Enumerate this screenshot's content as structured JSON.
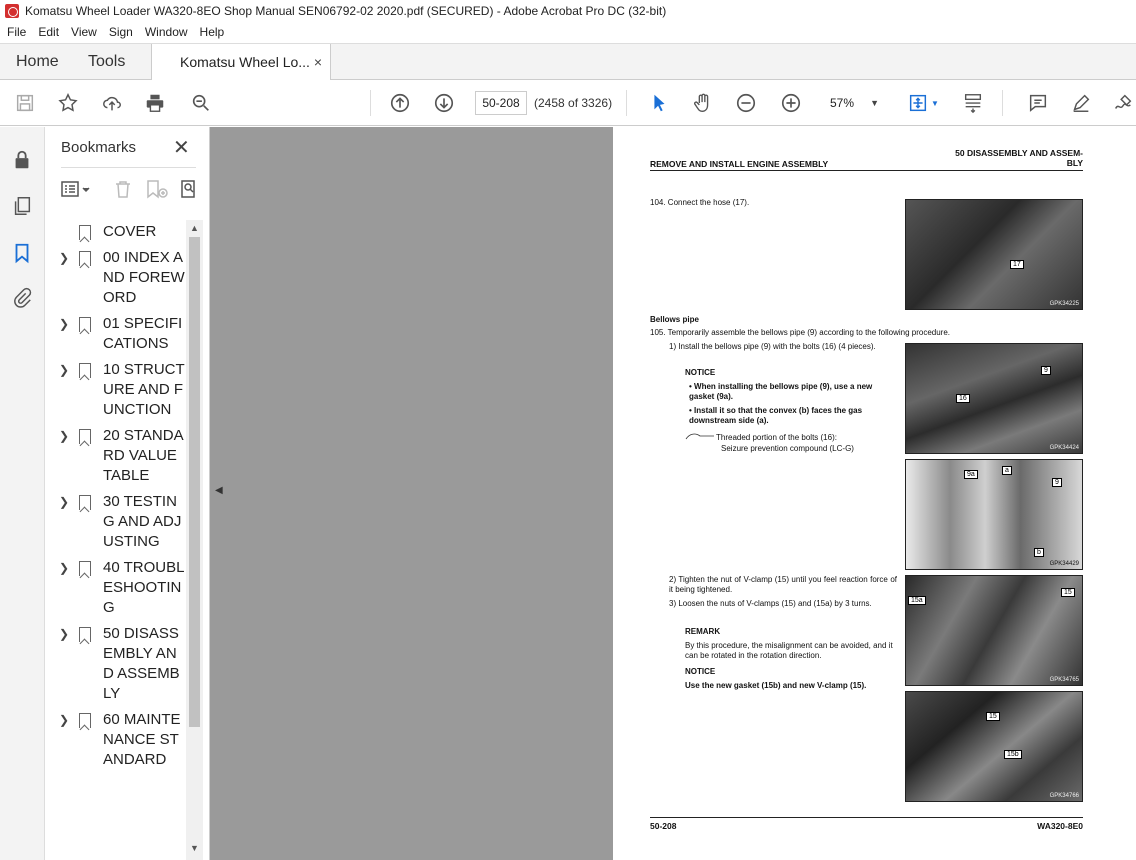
{
  "window": {
    "title": "Komatsu Wheel Loader WA320-8EO Shop Manual SEN06792-02 2020.pdf (SECURED) - Adobe Acrobat Pro DC (32-bit)"
  },
  "menu": [
    "File",
    "Edit",
    "View",
    "Sign",
    "Window",
    "Help"
  ],
  "tabs": {
    "home": "Home",
    "tools": "Tools",
    "doc": "Komatsu Wheel Lo...",
    "close": "×"
  },
  "toolbar": {
    "page_input": "50-208",
    "page_count": "(2458 of 3326)",
    "zoom": "57%"
  },
  "icons": [
    "save-icon",
    "star-icon",
    "upload-icon",
    "print-icon",
    "zoom-search-icon",
    "arrow-up-icon",
    "arrow-down-icon",
    "cursor-icon",
    "hand-icon",
    "zoom-out-icon",
    "zoom-in-icon",
    "fit-page-icon",
    "scroll-mode-icon",
    "comment-icon",
    "pen-icon",
    "sign-icon"
  ],
  "bookmarks": {
    "title": "Bookmarks",
    "close": "✕",
    "items": [
      {
        "label": "COVER",
        "expandable": false
      },
      {
        "label": "00 INDEX AND FOREWORD",
        "expandable": true
      },
      {
        "label": "01 SPECIFICATIONS",
        "expandable": true
      },
      {
        "label": "10 STRUCTURE AND FUNCTION",
        "expandable": true
      },
      {
        "label": "20 STANDARD VALUE TABLE",
        "expandable": true
      },
      {
        "label": "30 TESTING AND ADJUSTING",
        "expandable": true
      },
      {
        "label": "40 TROUBLESHOOTING",
        "expandable": true
      },
      {
        "label": "50 DISASSEMBLY AND ASSEMBLY",
        "expandable": true
      },
      {
        "label": "60 MAINTENANCE STANDARD",
        "expandable": true
      }
    ]
  },
  "page": {
    "header_right": "50 DISASSEMBLY AND ASSEM-BLY",
    "header_left": "REMOVE AND INSTALL ENGINE ASSEMBLY",
    "step104": "104. Connect the hose (17).",
    "section": "Bellows pipe",
    "step105": "105. Temporarily assemble the bellows pipe (9) according to the following procedure.",
    "s1": "1)   Install the bellows pipe (9) with the bolts (16) (4 pieces).",
    "notice1": "NOTICE",
    "bullet1": "• When installing the bellows pipe (9), use a new gasket (9a).",
    "bullet2": "• Install it so that the convex (b) faces the gas downstream side (a).",
    "thread1": "Threaded portion of the bolts (16):",
    "thread2": "Seizure prevention compound (LC-G)",
    "s2": "2)   Tighten the nut of V-clamp (15) until you feel reaction force of it being tightened.",
    "s3": "3)   Loosen the nuts of V-clamps (15) and (15a) by 3 turns.",
    "remark": "REMARK",
    "remark_text": "By this procedure, the misalignment can be avoided, and it can be rotated in the rotation direction.",
    "notice2": "NOTICE",
    "notice2_text": "Use the new gasket (15b) and new V-clamp (15).",
    "photos": [
      {
        "code": "GPK34225",
        "labels": [
          "17"
        ]
      },
      {
        "code": "GPK34424",
        "labels": [
          "16",
          "9"
        ]
      },
      {
        "code": "GPK34429",
        "labels": [
          "9a",
          "a",
          "9",
          "b"
        ]
      },
      {
        "code": "GPK34765",
        "labels": [
          "15a",
          "15"
        ]
      },
      {
        "code": "GPK34766",
        "labels": [
          "15",
          "15b"
        ]
      }
    ],
    "footer_left": "50-208",
    "footer_right": "WA320-8E0"
  }
}
